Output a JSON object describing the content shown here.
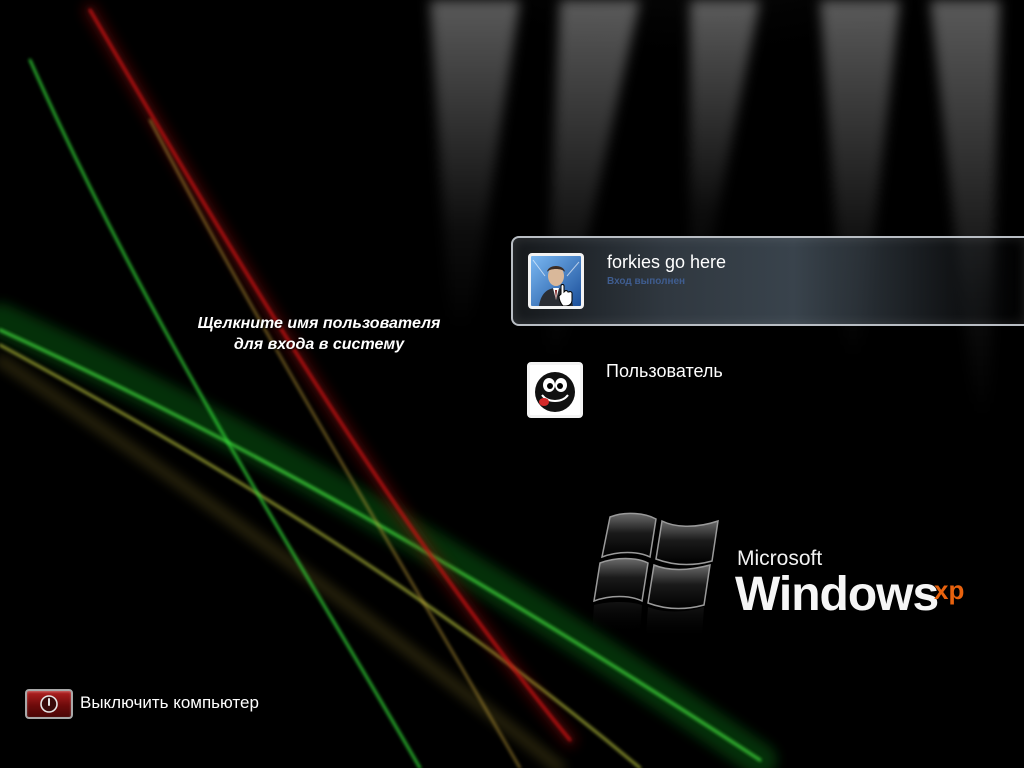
{
  "prompt": {
    "line1": "Щелкните имя пользователя",
    "line2": "для входа в систему"
  },
  "users": [
    {
      "name": "forkies go here",
      "status": "Вход выполнен",
      "selected": true,
      "avatar": "businessman-hand-icon"
    },
    {
      "name": "Пользователь",
      "selected": false,
      "avatar": "black-smiley-icon"
    }
  ],
  "branding": {
    "company": "Microsoft",
    "product": "Windows",
    "edition": "xp"
  },
  "power": {
    "label": "Выключить компьютер",
    "icon": "power-icon"
  },
  "colors": {
    "background": "#000000",
    "selected_tile_border": "#b9bec4",
    "status_text": "#3f5d90",
    "power_button": "#8a1010"
  }
}
